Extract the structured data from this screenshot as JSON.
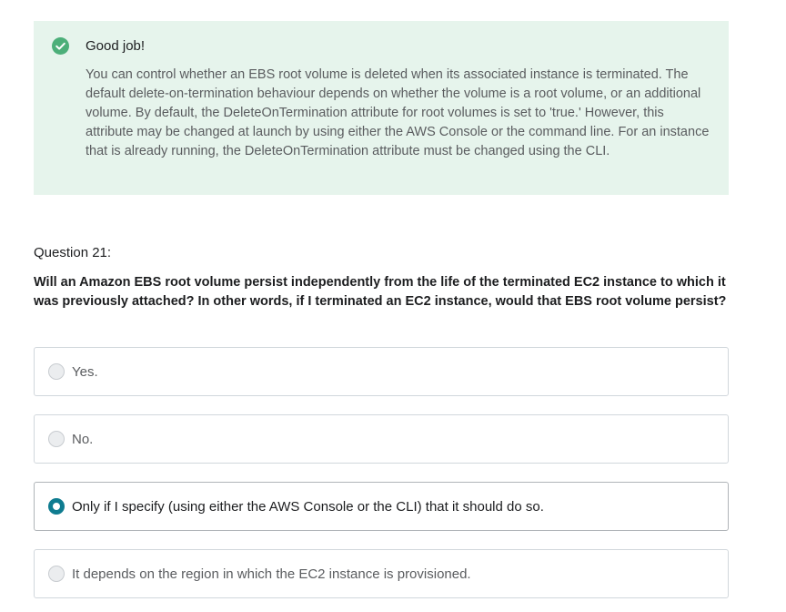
{
  "feedback": {
    "icon": "check-circle-icon",
    "color": "#4caf79",
    "background": "#e6f4ec",
    "title": "Good job!",
    "text": "You can control whether an EBS root volume is deleted when its associated instance is terminated. The default delete-on-termination behaviour depends on whether the volume is a root volume, or an additional volume. By default, the DeleteOnTermination attribute for root volumes is set to 'true.' However, this attribute may be changed at launch by using either the AWS Console or the command line. For an instance that is already running, the DeleteOnTermination attribute must be changed using the CLI."
  },
  "question": {
    "number_label": "Question 21:",
    "text": "Will an Amazon EBS root volume persist independently from the life of the terminated EC2 instance to which it was previously attached? In other words, if I terminated an EC2 instance, would that EBS root volume persist?"
  },
  "options": [
    {
      "label": "Yes.",
      "selected": false
    },
    {
      "label": "No.",
      "selected": false
    },
    {
      "label": "Only if I specify (using either the AWS Console or the CLI) that it should do so.",
      "selected": true
    },
    {
      "label": "It depends on the region in which the EC2 instance is provisioned.",
      "selected": false
    }
  ],
  "colors": {
    "selected_radio": "#0f7c90",
    "border": "#d1d7dc"
  }
}
